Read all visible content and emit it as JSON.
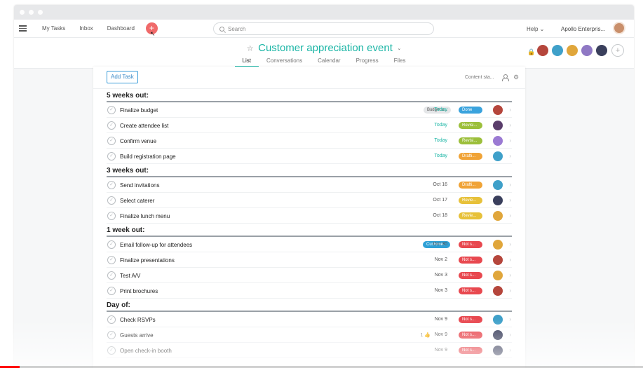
{
  "nav": {
    "links": [
      "My Tasks",
      "Inbox",
      "Dashboard"
    ],
    "add_symbol": "+",
    "search_placeholder": "Search",
    "help": "Help ⌄",
    "org": "Apollo Enterpris..."
  },
  "project": {
    "title": "Customer appreciation event",
    "star": "☆",
    "caret": "⌄",
    "tabs": [
      "List",
      "Conversations",
      "Calendar",
      "Progress",
      "Files"
    ],
    "active_tab": "List",
    "lock_symbol": "🔒",
    "add_member_symbol": "+",
    "member_colors": [
      "#b5463c",
      "#3fa0c9",
      "#e0a63b",
      "#8f78c4",
      "#3a3f5c"
    ]
  },
  "toolbar": {
    "add_task": "Add Task",
    "content_status": "Content sta...",
    "person_icon": "person-icon",
    "gear_icon": "gear-icon"
  },
  "status_colors": {
    "Done": "#3aa3dd",
    "Revisi...": "#9cbf3b",
    "Drafti...": "#f0a336",
    "Revie...": "#e7c13a",
    "Not s...": "#e8484f"
  },
  "sections": [
    {
      "title": "5 weeks out:",
      "tasks": [
        {
          "name": "Finalize budget",
          "tag": "Budget a...",
          "due": "Today",
          "due_today": true,
          "status": "Done",
          "avatar": "#b5463c"
        },
        {
          "name": "Create attendee list",
          "due": "Today",
          "due_today": true,
          "status": "Revisi...",
          "avatar": "#5a3d6b"
        },
        {
          "name": "Confirm venue",
          "due": "Today",
          "due_today": true,
          "status": "Revisi...",
          "avatar": "#9b7ad3"
        },
        {
          "name": "Build registration page",
          "due": "Today",
          "due_today": true,
          "status": "Drafti...",
          "avatar": "#3fa0c9"
        }
      ]
    },
    {
      "title": "3 weeks out:",
      "tasks": [
        {
          "name": "Send invitations",
          "due": "Oct 16",
          "due_today": false,
          "status": "Drafti...",
          "avatar": "#3fa0c9"
        },
        {
          "name": "Select caterer",
          "due": "Oct 17",
          "due_today": false,
          "status": "Revie...",
          "avatar": "#3a3f5c"
        },
        {
          "name": "Finalize lunch menu",
          "due": "Oct 18",
          "due_today": false,
          "status": "Revie...",
          "avatar": "#e0a63b"
        }
      ]
    },
    {
      "title": "1 week out:",
      "tasks": [
        {
          "name": "Email follow-up for attendees",
          "custom_tag": "Custome...",
          "due": "Oct 30",
          "due_today": false,
          "status": "Not s...",
          "avatar": "#e0a63b"
        },
        {
          "name": "Finalize presentations",
          "due": "Nov 2",
          "due_today": false,
          "status": "Not s...",
          "avatar": "#b5463c"
        },
        {
          "name": "Test A/V",
          "due": "Nov 3",
          "due_today": false,
          "status": "Not s...",
          "avatar": "#e0a63b"
        },
        {
          "name": "Print brochures",
          "due": "Nov 3",
          "due_today": false,
          "status": "Not s...",
          "avatar": "#b5463c"
        }
      ]
    },
    {
      "title": "Day of:",
      "tasks": [
        {
          "name": "Check RSVPs",
          "due": "Nov 9",
          "due_today": false,
          "status": "Not s...",
          "avatar": "#3fa0c9"
        },
        {
          "name": "Guests arrive",
          "likes": "1 👍",
          "due": "Nov 9",
          "due_today": false,
          "status": "Not s...",
          "avatar": "#3a3f5c"
        },
        {
          "name": "Open check-in booth",
          "due": "Nov 9",
          "due_today": false,
          "status": "Not s...",
          "avatar": "#3a3f5c"
        }
      ]
    }
  ],
  "video_progress": 0.03
}
